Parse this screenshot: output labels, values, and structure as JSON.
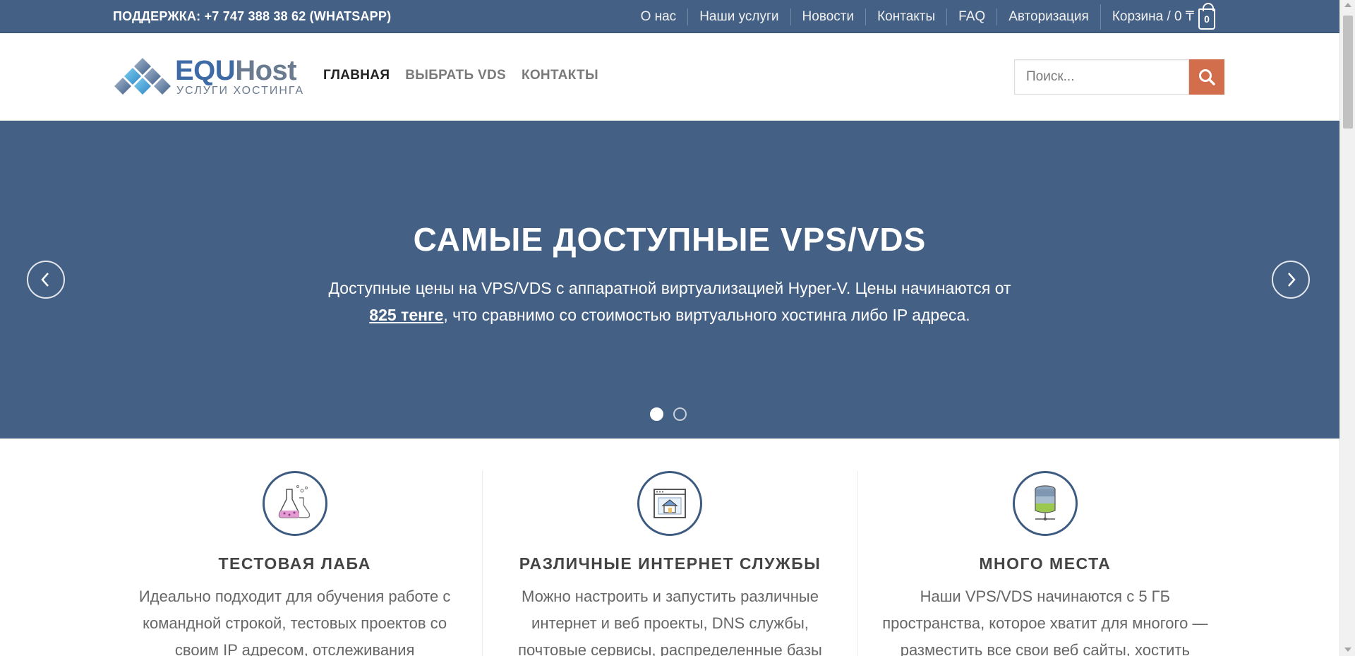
{
  "topbar": {
    "support": "ПОДДЕРЖКА: +7 747 388 38 62 (WHATSAPP)",
    "links": [
      "О нас",
      "Наши услуги",
      "Новости",
      "Контакты",
      "FAQ",
      "Авторизация"
    ],
    "cart_label": "Корзина / 0 ₸",
    "cart_count": "0"
  },
  "header": {
    "logo_part1": "EQU",
    "logo_part2": "Host",
    "logo_sub": "УСЛУГИ ХОСТИНГА",
    "nav": [
      "ГЛАВНАЯ",
      "ВЫБРАТЬ VDS",
      "КОНТАКТЫ"
    ],
    "search_placeholder": "Поиск..."
  },
  "hero": {
    "title": "САМЫЕ ДОСТУПНЫЕ VPS/VDS",
    "text_before": "Доступные цены на VPS/VDS с аппаратной виртуализацией Hyper-V. Цены начинаются от ",
    "price": "825 тенге",
    "text_after": ", что сравнимо со стоимостью виртуального хостинга либо IP адреса.",
    "slides": 2,
    "active_slide": 1
  },
  "features": [
    {
      "icon": "flask-icon",
      "title": "ТЕСТОВАЯ ЛАБА",
      "text": "Идеально подходит для обучения работе с командной строкой, тестовых проектов со своим IP адресом, отслеживания"
    },
    {
      "icon": "web-house-icon",
      "title": "РАЗЛИЧНЫЕ ИНТЕРНЕТ СЛУЖБЫ",
      "text": "Можно настроить и запустить различные интернет и веб проекты, DNS службы, почтовые сервисы, распределенные базы"
    },
    {
      "icon": "database-icon",
      "title": "МНОГО МЕСТА",
      "text": "Наши VPS/VDS начинаются с 5 ГБ пространства, которое хватит для многого — разместить все свои веб сайты, хостить"
    }
  ],
  "colors": {
    "brand_blue": "#446084",
    "accent_orange": "#d26e4b"
  }
}
